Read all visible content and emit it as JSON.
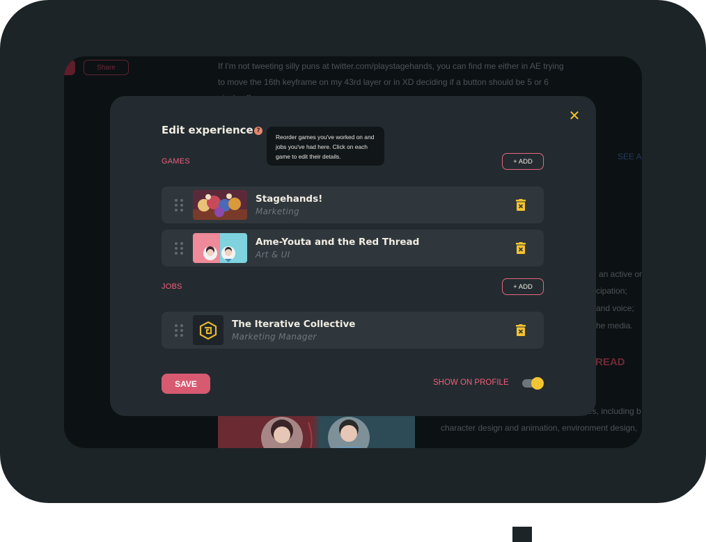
{
  "background": {
    "share_label": "Share",
    "bio_lines": [
      "If I'm not tweeting silly puns at twitter.com/playstagehands, you can find me either in AE trying",
      "to move the 16th keyframe on my 43rd layer or in XD deciding if a button should be 5 or 6",
      "pixels off"
    ],
    "see_all": "SEE A",
    "right_lines": [
      "an active or",
      "cipation;",
      "and voice;",
      "he media."
    ],
    "read_label": "READ",
    "bottom_lines": [
      "es, including b",
      "character design and animation, environment design,"
    ]
  },
  "modal": {
    "title": "Edit experience",
    "tooltip": "Reorder games you've worked on and jobs you've had here. Click on each game to edit their details.",
    "games_label": "GAMES",
    "jobs_label": "JOBS",
    "add_label": "+ ADD",
    "games": [
      {
        "title": "Stagehands!",
        "role": "Marketing"
      },
      {
        "title": "Ame-Youta and the Red Thread",
        "role": "Art & UI"
      }
    ],
    "jobs": [
      {
        "title": "The Iterative Collective",
        "role": "Marketing Manager"
      }
    ],
    "save_label": "SAVE",
    "show_on_profile_label": "SHOW ON PROFILE",
    "show_on_profile": true
  },
  "colors": {
    "accent_yellow": "#f5c431",
    "accent_pink": "#ef5f79",
    "save_button": "#d85a71",
    "modal_bg": "#232b30",
    "row_bg": "#2f373c"
  },
  "icons": {
    "close": "close-icon",
    "help": "question-icon",
    "drag": "drag-handle-icon",
    "delete": "trash-icon"
  }
}
